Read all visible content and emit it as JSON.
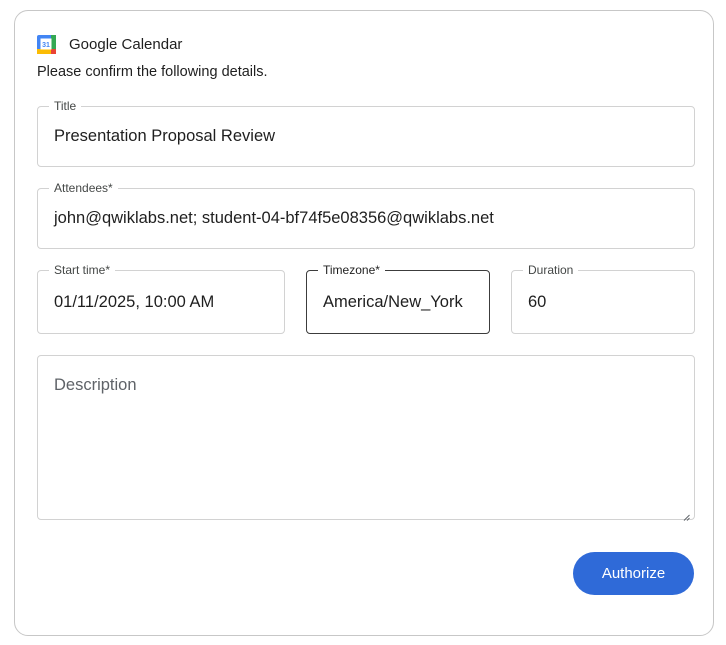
{
  "header": {
    "app_name": "Google Calendar",
    "icon": "google-calendar-icon",
    "icon_day": "31"
  },
  "subtitle": "Please confirm the following details.",
  "form": {
    "title": {
      "label": "Title",
      "value": "Presentation Proposal Review"
    },
    "attendees": {
      "label": "Attendees*",
      "value": "john@qwiklabs.net; student-04-bf74f5e08356@qwiklabs.net"
    },
    "start_time": {
      "label": "Start time*",
      "value": "01/11/2025, 10:00 AM"
    },
    "timezone": {
      "label": "Timezone*",
      "value": "America/New_York"
    },
    "duration": {
      "label": "Duration",
      "value": "60"
    },
    "description": {
      "placeholder": "Description",
      "value": ""
    }
  },
  "actions": {
    "authorize_label": "Authorize"
  },
  "colors": {
    "accent": "#2f6ad8",
    "border": "#d2d2d2",
    "focused_border": "#3c3c3c"
  }
}
